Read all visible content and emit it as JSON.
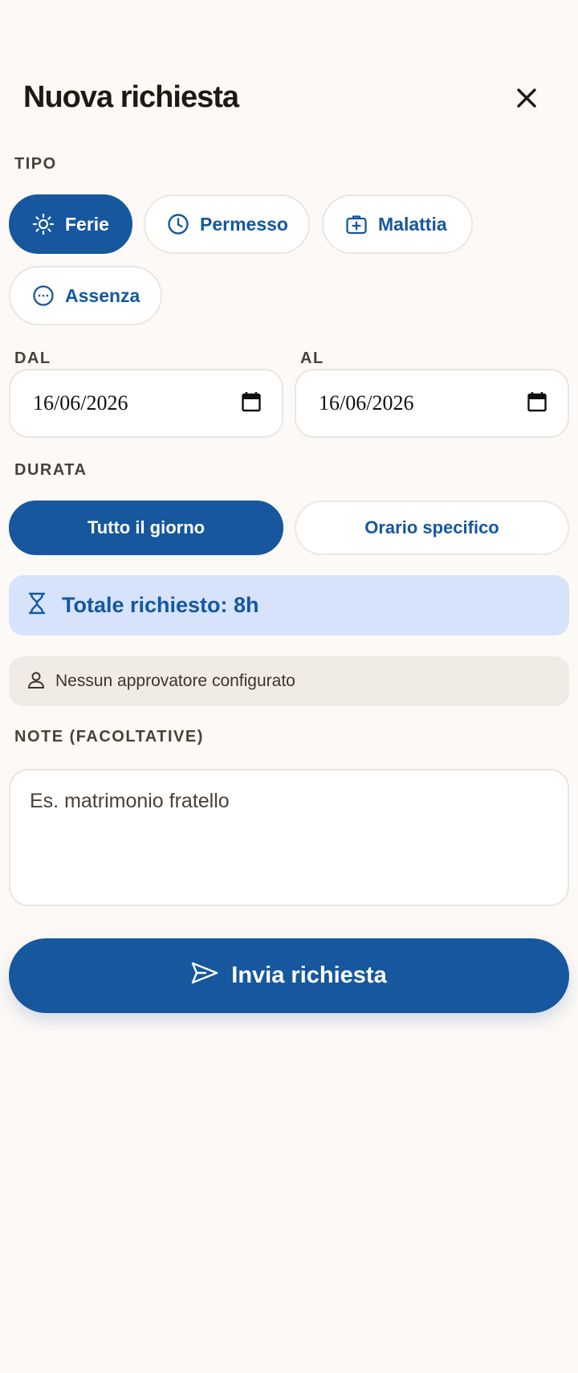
{
  "header": {
    "title": "Nuova richiesta",
    "close_icon": "close-icon"
  },
  "type_section": {
    "label": "TIPO",
    "options": [
      {
        "label": "Ferie",
        "icon": "sun-icon",
        "selected": true
      },
      {
        "label": "Permesso",
        "icon": "clock-icon",
        "selected": false
      },
      {
        "label": "Malattia",
        "icon": "medical-kit-icon",
        "selected": false
      },
      {
        "label": "Assenza",
        "icon": "more-circle-icon",
        "selected": false
      }
    ]
  },
  "dates": {
    "from_label": "DAL",
    "from_value": "16/06/2026",
    "to_label": "AL",
    "to_value": "16/06/2026",
    "calendar_icon": "calendar-icon"
  },
  "duration": {
    "label": "DURATA",
    "options": [
      {
        "label": "Tutto il giorno",
        "selected": true
      },
      {
        "label": "Orario specifico",
        "selected": false
      }
    ]
  },
  "total": {
    "text": "Totale richiesto: 8h",
    "icon": "hourglass-icon"
  },
  "approver": {
    "text": "Nessun approvatore configurato",
    "icon": "user-icon"
  },
  "notes": {
    "label": "NOTE (FACOLTATIVE)",
    "placeholder": "Es. matrimonio fratello",
    "value": ""
  },
  "submit": {
    "label": "Invia richiesta",
    "icon": "send-icon"
  },
  "colors": {
    "background": "#fdf9f6",
    "primary": "#16579e",
    "total_bg": "#d6e3fb",
    "approver_bg": "#f1ebe6",
    "border": "#ece6e1"
  }
}
